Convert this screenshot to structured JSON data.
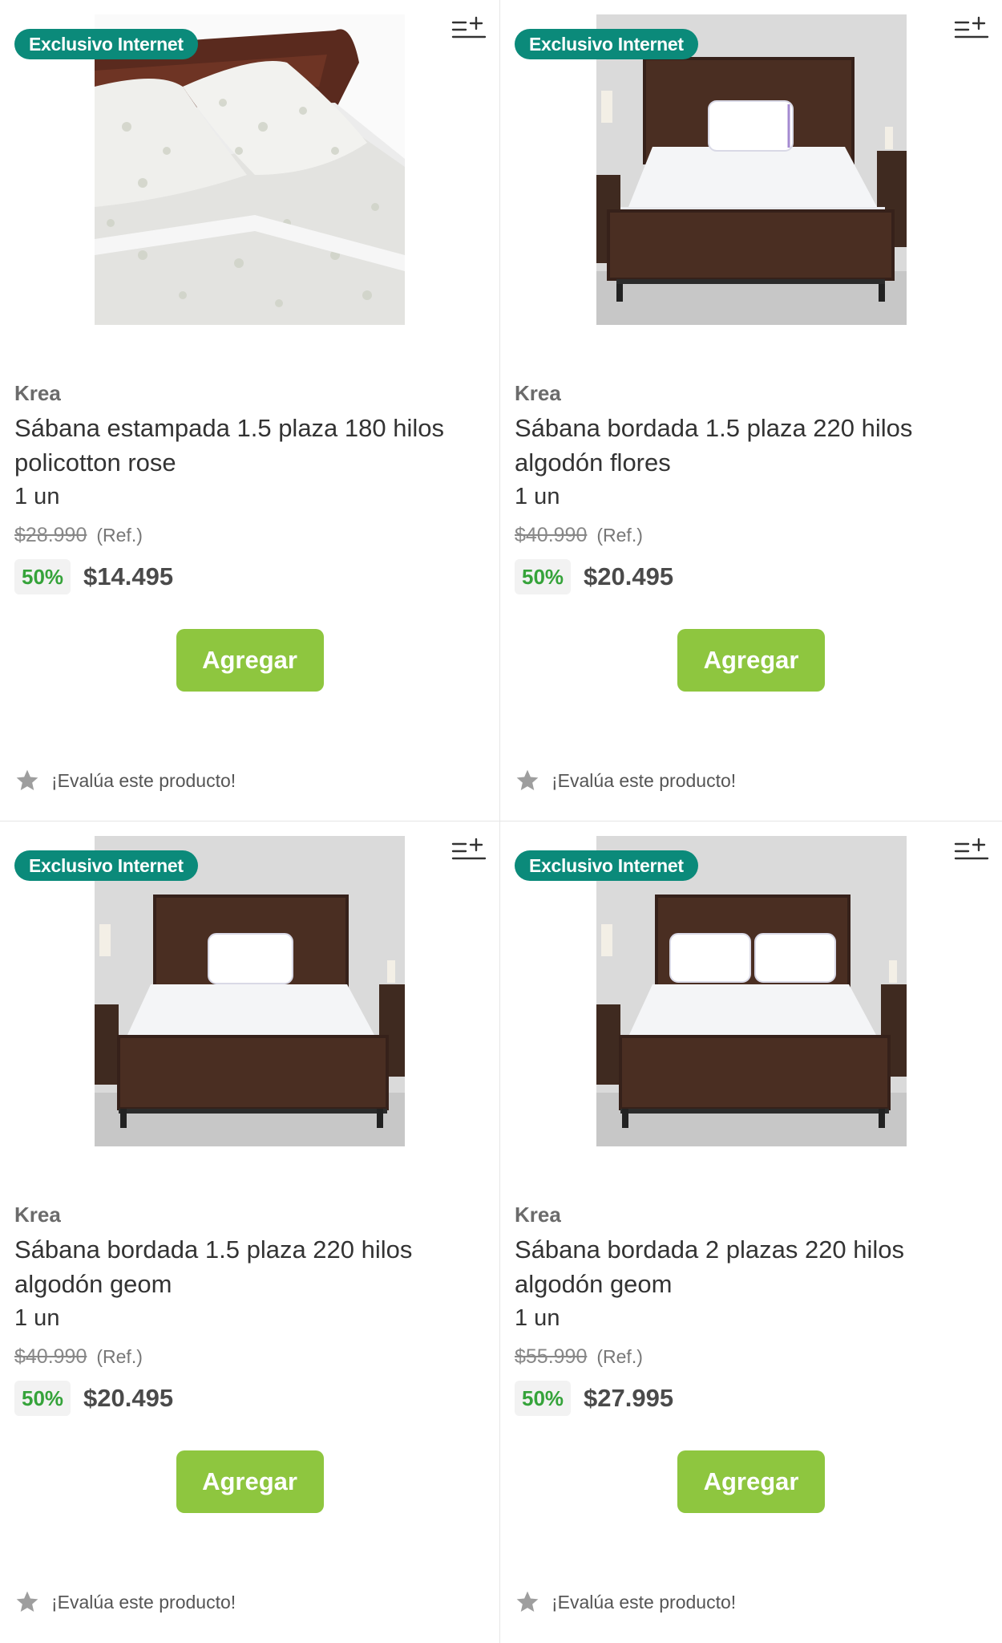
{
  "badge_label": "Exclusivo Internet",
  "ref_label": "(Ref.)",
  "add_label": "Agregar",
  "rate_label": "¡Evalúa este producto!",
  "colors": {
    "badge": "#0b8a7a",
    "button": "#8ec63f",
    "discount_text": "#35a33a"
  },
  "products": [
    {
      "brand": "Krea",
      "name": "Sábana estampada 1.5 plaza 180 hilos policotton rose",
      "unit": "1 un",
      "old_price": "$28.990",
      "discount": "50%",
      "price": "$14.495",
      "image": "patterned-sheet-closeup"
    },
    {
      "brand": "Krea",
      "name": "Sábana bordada 1.5 plaza 220 hilos algodón flores",
      "unit": "1 un",
      "old_price": "$40.990",
      "discount": "50%",
      "price": "$20.495",
      "image": "bed-one-pillow"
    },
    {
      "brand": "Krea",
      "name": "Sábana bordada 1.5 plaza 220 hilos algodón geom",
      "unit": "1 un",
      "old_price": "$40.990",
      "discount": "50%",
      "price": "$20.495",
      "image": "bed-one-pillow"
    },
    {
      "brand": "Krea",
      "name": "Sábana bordada 2 plazas 220 hilos algodón geom",
      "unit": "1 un",
      "old_price": "$55.990",
      "discount": "50%",
      "price": "$27.995",
      "image": "bed-two-pillows"
    }
  ]
}
